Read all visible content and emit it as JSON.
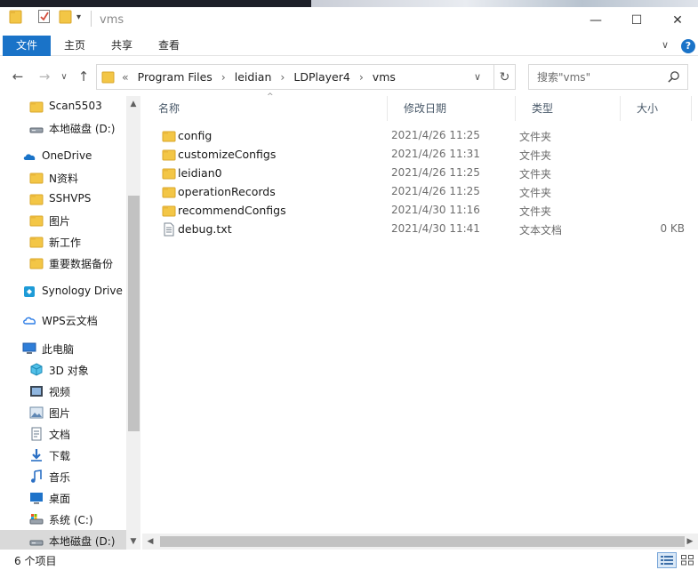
{
  "window": {
    "title": "vms",
    "minimize": "—",
    "maximize": "☐",
    "close": "✕"
  },
  "ribbon": {
    "tabs": [
      "文件",
      "主页",
      "共享",
      "查看"
    ],
    "collapse": "∨",
    "help": "?"
  },
  "nav": {
    "back": "←",
    "forward": "→",
    "recent": "∨",
    "up": "↑",
    "overflow": "«",
    "breadcrumbs": [
      "Program Files",
      "leidian",
      "LDPlayer4",
      "vms"
    ],
    "separator": "›",
    "refresh": "↻",
    "dropdown": "∨"
  },
  "search": {
    "placeholder": "搜索\"vms\""
  },
  "sidebar": {
    "items": [
      {
        "label": "Scan5503",
        "icon": "folder-icon",
        "level": 2
      },
      {
        "label": "本地磁盘 (D:)",
        "icon": "drive-icon",
        "level": 2
      },
      {
        "label": "OneDrive",
        "icon": "onedrive-icon",
        "level": 1
      },
      {
        "label": "N资料",
        "icon": "folder-icon",
        "level": 2
      },
      {
        "label": "SSHVPS",
        "icon": "folder-icon",
        "level": 2
      },
      {
        "label": "图片",
        "icon": "folder-icon",
        "level": 2
      },
      {
        "label": "新工作",
        "icon": "folder-icon",
        "level": 2
      },
      {
        "label": "重要数据备份",
        "icon": "folder-icon",
        "level": 2
      },
      {
        "label": "Synology Drive -",
        "icon": "synology-icon",
        "level": 1
      },
      {
        "label": "WPS云文档",
        "icon": "wps-cloud-icon",
        "level": 1
      },
      {
        "label": "此电脑",
        "icon": "computer-icon",
        "level": 1
      },
      {
        "label": "3D 对象",
        "icon": "3d-objects-icon",
        "level": 2
      },
      {
        "label": "视频",
        "icon": "video-icon",
        "level": 2
      },
      {
        "label": "图片",
        "icon": "pictures-icon",
        "level": 2
      },
      {
        "label": "文档",
        "icon": "documents-icon",
        "level": 2
      },
      {
        "label": "下载",
        "icon": "download-icon",
        "level": 2
      },
      {
        "label": "音乐",
        "icon": "music-icon",
        "level": 2
      },
      {
        "label": "桌面",
        "icon": "desktop-icon",
        "level": 2
      },
      {
        "label": "系统 (C:)",
        "icon": "system-drive-icon",
        "level": 2
      },
      {
        "label": "本地磁盘 (D:)",
        "icon": "drive-icon",
        "level": 2,
        "selected": true
      }
    ]
  },
  "columns": [
    "名称",
    "修改日期",
    "类型",
    "大小"
  ],
  "sort_indicator": "^",
  "files": [
    {
      "name": "config",
      "date": "2021/4/26 11:25",
      "type": "文件夹",
      "size": "",
      "icon": "folder-icon"
    },
    {
      "name": "customizeConfigs",
      "date": "2021/4/26 11:31",
      "type": "文件夹",
      "size": "",
      "icon": "folder-icon"
    },
    {
      "name": "leidian0",
      "date": "2021/4/26 11:25",
      "type": "文件夹",
      "size": "",
      "icon": "folder-icon"
    },
    {
      "name": "operationRecords",
      "date": "2021/4/26 11:25",
      "type": "文件夹",
      "size": "",
      "icon": "folder-icon"
    },
    {
      "name": "recommendConfigs",
      "date": "2021/4/30 11:16",
      "type": "文件夹",
      "size": "",
      "icon": "folder-icon"
    },
    {
      "name": "debug.txt",
      "date": "2021/4/30 11:41",
      "type": "文本文档",
      "size": "0 KB",
      "icon": "text-file-icon"
    }
  ],
  "scroll": {
    "up": "▲",
    "down": "▼",
    "left": "◀",
    "right": "▶"
  },
  "status": {
    "count": "6 个项目"
  },
  "colors": {
    "accent": "#1a73c8",
    "folder": "#f3c646",
    "selected": "#d9d9d9"
  }
}
